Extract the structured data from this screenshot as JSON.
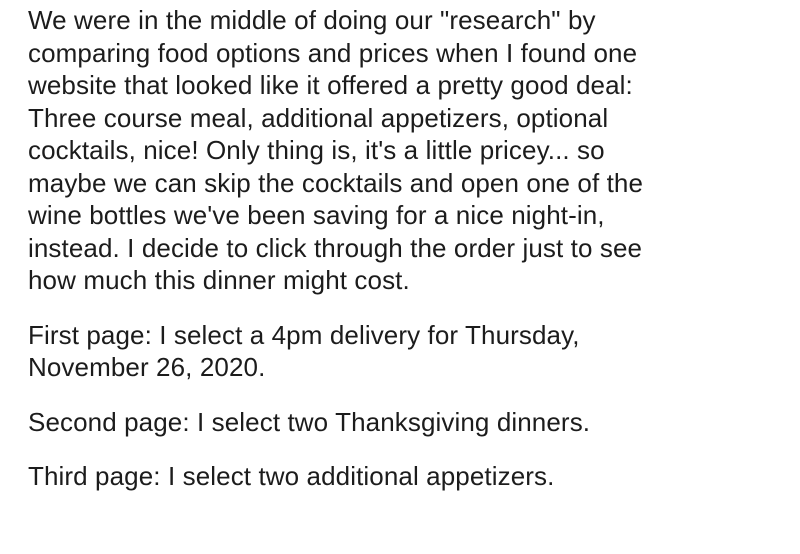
{
  "post": {
    "paragraphs": [
      "We were in the middle of doing our \"research\" by\ncomparing food options and prices when I found one\nwebsite that looked like it offered a pretty good deal:\nThree course meal, additional appetizers, optional\ncocktails, nice! Only thing is, it's a little pricey... so\nmaybe we can skip the cocktails and open one of the\nwine bottles we've been saving for a nice night-in,\ninstead. I decide to click through the order just to see\nhow much this dinner might cost.",
      "First page: I select a 4pm delivery for Thursday,\nNovember 26, 2020.",
      "Second page: I select two Thanksgiving dinners.",
      "Third page: I select two additional appetizers."
    ]
  }
}
